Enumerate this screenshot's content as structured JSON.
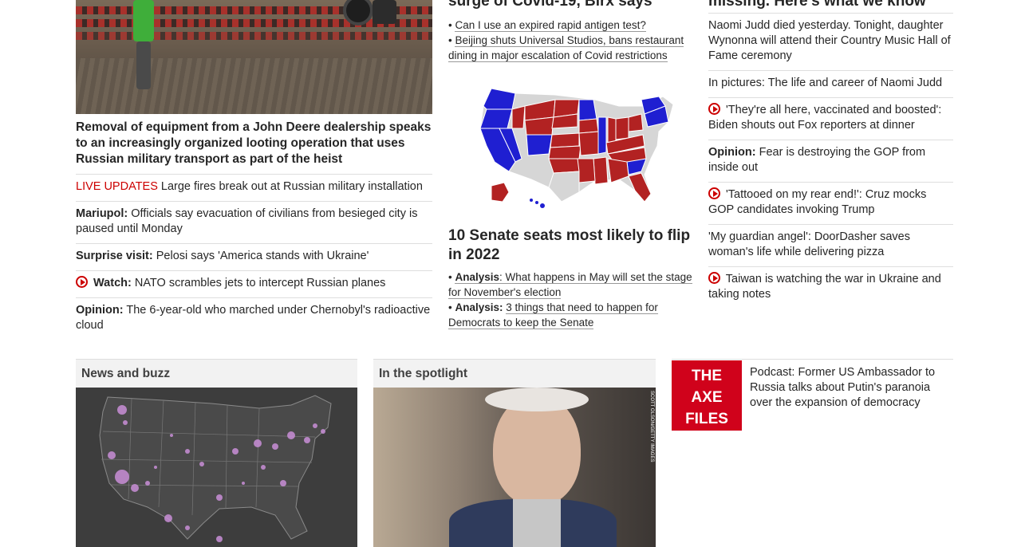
{
  "col1": {
    "main_headline": "Removal of equipment from a John Deere dealership speaks to an increasingly organized looting operation that uses Russian military transport as part of the heist",
    "items": [
      {
        "prefix": "LIVE UPDATES",
        "text": "Large fires break out at Russian military installation"
      },
      {
        "prefix": "Mariupol:",
        "text": "Officials say evacuation of civilians from besieged city is paused until Monday"
      },
      {
        "prefix": "Surprise visit:",
        "text": "Pelosi says 'America stands with Ukraine'"
      },
      {
        "prefix": "Watch:",
        "text": "NATO scrambles jets to intercept Russian planes"
      },
      {
        "prefix": "Opinion:",
        "text": "The 6-year-old who marched under Chernobyl's radioactive cloud"
      }
    ]
  },
  "col2": {
    "top_headline": "surge of Covid-19, Birx says",
    "top_bullets": [
      "Can I use an expired rapid antigen test?",
      "Beijing shuts Universal Studios, bans restaurant dining in major escalation of Covid restrictions"
    ],
    "senate_headline": "10 Senate seats most likely to flip in 2022",
    "senate_bullets": [
      {
        "prefix": "Analysis",
        "text": ": What happens in May will set the stage for November's election"
      },
      {
        "prefix": "Analysis:",
        "text": "3 things that need to happen for Democrats to keep the Senate"
      }
    ]
  },
  "col3": {
    "top_headline": "missing. Here's what we know",
    "items": [
      {
        "prefix": "",
        "text": "Naomi Judd died yesterday. Tonight, daughter Wynonna will attend their Country Music Hall of Fame ceremony",
        "video": false
      },
      {
        "prefix": "",
        "text": "In pictures: The life and career of Naomi Judd",
        "video": false
      },
      {
        "prefix": "",
        "text": "'They're all here, vaccinated and boosted': Biden shouts out Fox reporters at dinner",
        "video": true
      },
      {
        "prefix": "Opinion:",
        "text": "Fear is destroying the GOP from inside out",
        "video": false
      },
      {
        "prefix": "",
        "text": "'Tattooed on my rear end!': Cruz mocks GOP candidates invoking Trump",
        "video": true
      },
      {
        "prefix": "",
        "text": "'My guardian angel': DoorDasher saves woman's life while delivering pizza",
        "video": false
      },
      {
        "prefix": "",
        "text": "Taiwan is watching the war in Ukraine and taking notes",
        "video": true
      }
    ]
  },
  "bottom": {
    "news_buzz_title": "News and buzz",
    "spotlight_title": "In the spotlight",
    "photo_credit": "SCOTT OLSON/GETTY IMAGES",
    "axe_logo_lines": [
      "THE",
      "AXE",
      "FILES"
    ],
    "axe_text": "Podcast: Former US Ambassador to Russia talks about Putin's paranoia over the expansion of democracy"
  },
  "colors": {
    "accent_red": "#cc0000",
    "rep_red": "#b22222",
    "dem_blue": "#1f1fd1",
    "neutral_gray": "#d6d6d6"
  }
}
